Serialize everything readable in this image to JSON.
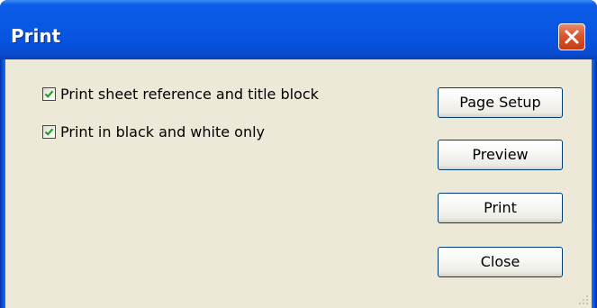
{
  "window": {
    "title": "Print"
  },
  "options": {
    "items": [
      {
        "label": "Print sheet reference and title block",
        "checked": true
      },
      {
        "label": "Print in black and white only",
        "checked": true
      }
    ]
  },
  "buttons": {
    "page_setup": "Page Setup",
    "preview": "Preview",
    "print": "Print",
    "close": "Close"
  },
  "icons": {
    "close": "close-icon",
    "check": "checkmark-icon",
    "grip": "resize-grip-icon"
  },
  "colors": {
    "titlebar": "#0a58e2",
    "client": "#ece9d8",
    "close_button": "#d9562e",
    "checkmark": "#21a121"
  }
}
